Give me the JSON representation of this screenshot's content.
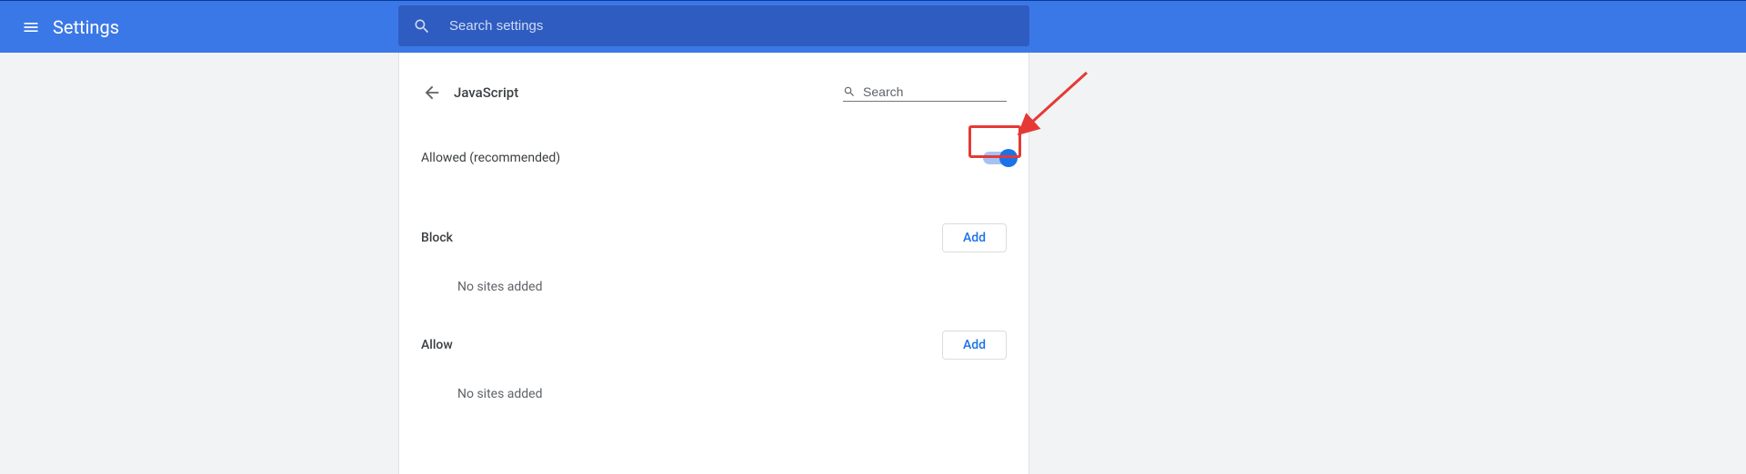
{
  "header": {
    "title": "Settings",
    "search_placeholder": "Search settings"
  },
  "page": {
    "title": "JavaScript",
    "inline_search_placeholder": "Search"
  },
  "setting": {
    "allowed_label": "Allowed (recommended)",
    "toggle_on": true
  },
  "sections": {
    "block": {
      "title": "Block",
      "add_label": "Add",
      "empty_text": "No sites added"
    },
    "allow": {
      "title": "Allow",
      "add_label": "Add",
      "empty_text": "No sites added"
    }
  },
  "annotation": {
    "highlight": "toggle",
    "arrow_points_to": "toggle"
  },
  "colors": {
    "primary": "#3b78e7",
    "accent": "#1a73e8",
    "highlight": "#e53935"
  }
}
